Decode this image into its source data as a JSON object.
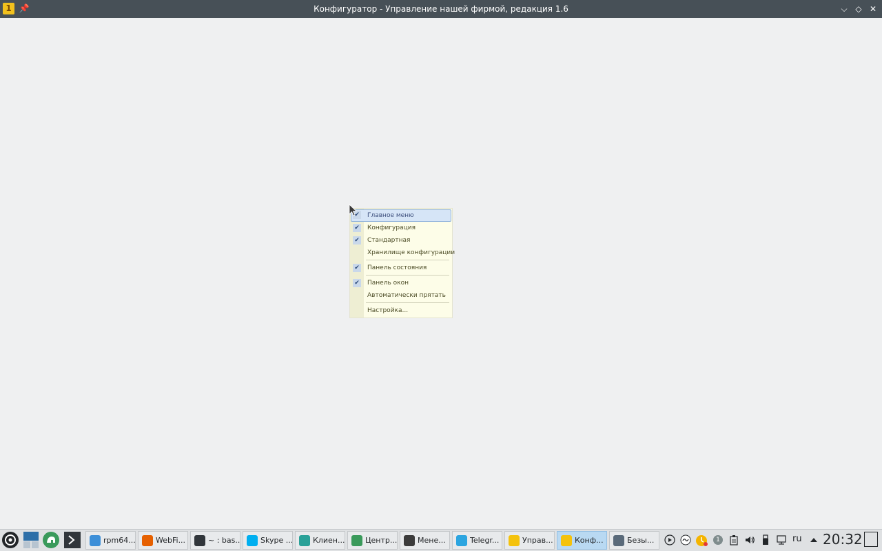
{
  "window": {
    "title": "Конфигуратор - Управление нашей фирмой, редакция 1.6",
    "controls": {
      "minimize": "⌵",
      "maximize": "◇",
      "close": "✕"
    }
  },
  "context_menu": {
    "items": [
      {
        "label": "Главное меню",
        "checked": true,
        "highlighted": true
      },
      {
        "label": "Конфигурация",
        "checked": true
      },
      {
        "label": "Стандартная",
        "checked": true
      },
      {
        "label": "Хранилище конфигурации",
        "checked": false
      },
      {
        "label": "Панель состояния",
        "checked": true
      },
      {
        "label": "Панель окон",
        "checked": true
      },
      {
        "label": "Автоматически прятать",
        "checked": false
      },
      {
        "label": "Настройка...",
        "checked": false
      }
    ],
    "check_glyph": "✔"
  },
  "taskbar": {
    "tasks": [
      {
        "label": "rpm64...",
        "icon": "folder-icon",
        "color": "#3d8fd8"
      },
      {
        "label": "WebFi...",
        "icon": "firefox-icon",
        "color": "#e66000"
      },
      {
        "label": "~ : bas...",
        "icon": "terminal-icon",
        "color": "#31363b"
      },
      {
        "label": "Skype ...",
        "icon": "skype-icon",
        "color": "#00aff0"
      },
      {
        "label": "Клиен...",
        "icon": "client-icon",
        "color": "#2aa198"
      },
      {
        "label": "Центр...",
        "icon": "center-icon",
        "color": "#3a9a5b"
      },
      {
        "label": "Мене...",
        "icon": "vm-icon",
        "color": "#3b3b3b"
      },
      {
        "label": "Telegr...",
        "icon": "telegram-icon",
        "color": "#2ca5e0"
      },
      {
        "label": "Управ...",
        "icon": "1c-icon",
        "color": "#f4c20d"
      },
      {
        "label": "Конф...",
        "icon": "1c-icon",
        "color": "#f4c20d",
        "active": true
      },
      {
        "label": "Безы...",
        "icon": "image-icon",
        "color": "#5a6a7a"
      }
    ],
    "language": "ru",
    "clock": "20:32",
    "tray_badge": "1"
  }
}
